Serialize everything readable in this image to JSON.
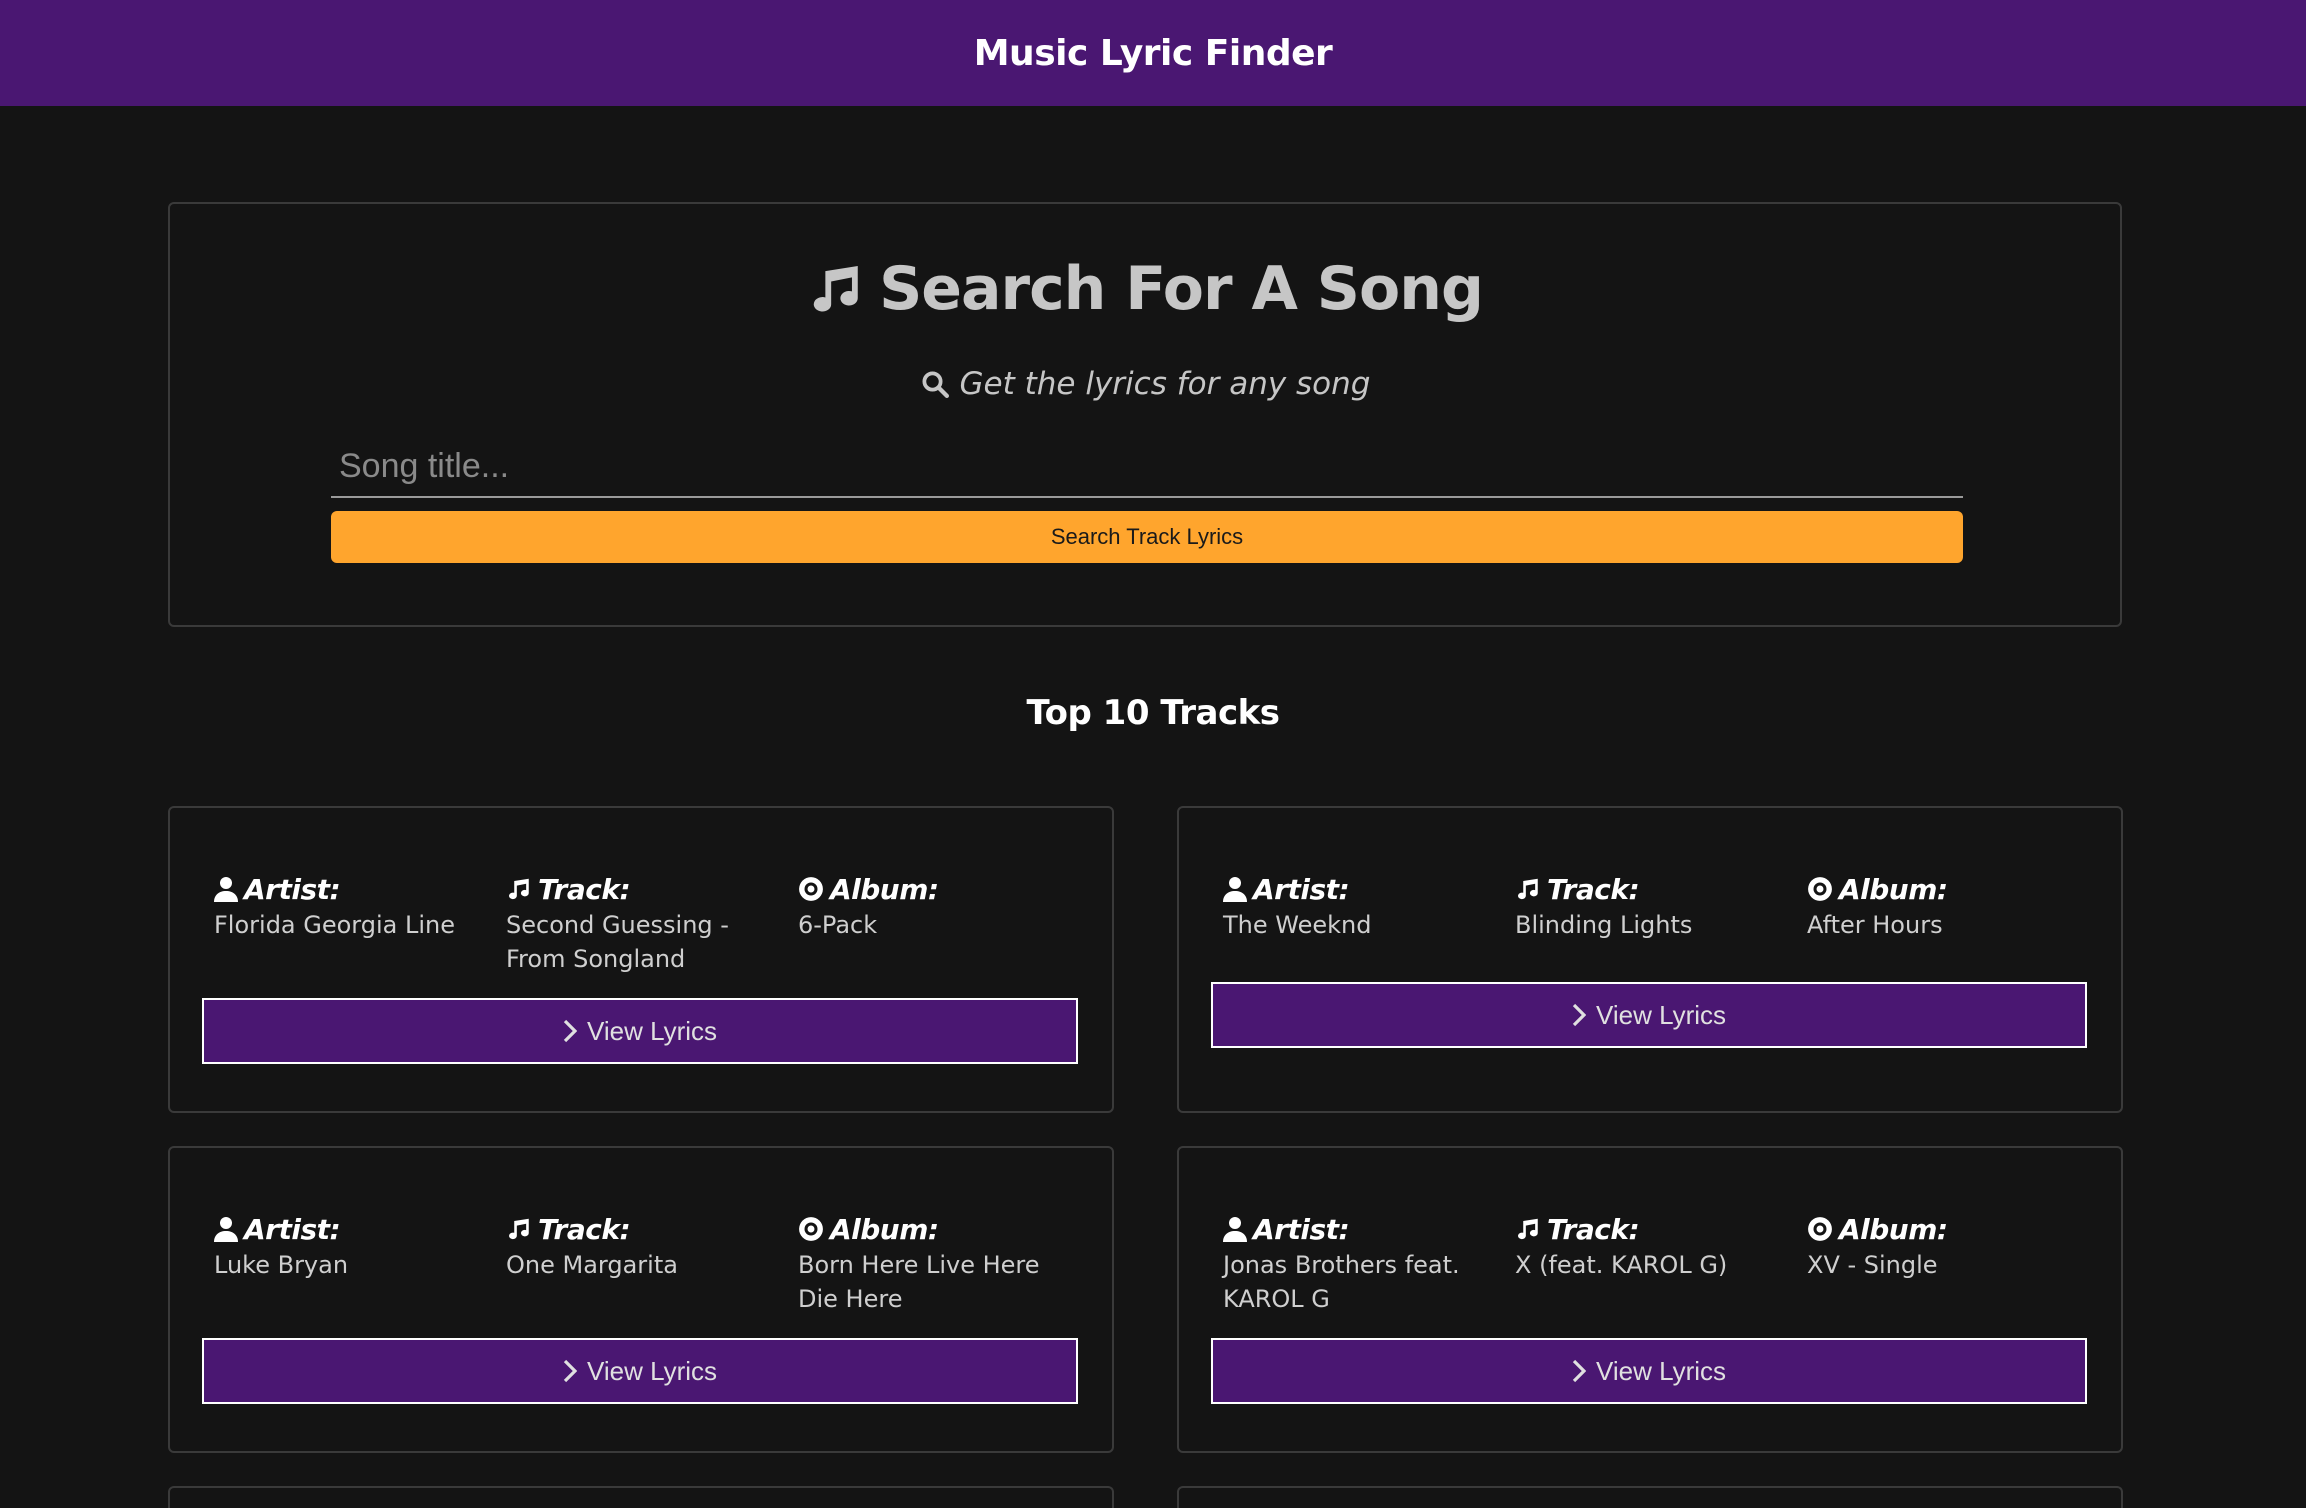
{
  "app": {
    "title": "Music Lyric Finder"
  },
  "search": {
    "title": "Search For A Song",
    "subtitle": "Get the lyrics for any song",
    "placeholder": "Song title...",
    "value": "",
    "button_label": "Search Track Lyrics",
    "title_icon": "music-note-icon",
    "subtitle_icon": "search-icon"
  },
  "top_tracks": {
    "title": "Top 10 Tracks",
    "labels": {
      "artist": "Artist:",
      "track": "Track:",
      "album": "Album:"
    },
    "button_label": "View Lyrics",
    "tracks": [
      {
        "artist": "Florida Georgia Line",
        "track": "Second Guessing - From Songland",
        "album": "6-Pack"
      },
      {
        "artist": "The Weeknd",
        "track": "Blinding Lights",
        "album": "After Hours"
      },
      {
        "artist": "Luke Bryan",
        "track": "One Margarita",
        "album": "Born Here Live Here Die Here"
      },
      {
        "artist": "Jonas Brothers feat. KAROL G",
        "track": "X (feat. KAROL G)",
        "album": "XV - Single"
      }
    ]
  },
  "colors": {
    "navbar": "#4a1772",
    "background": "#141414",
    "accent": "#ffa52d",
    "button_purple": "#4a1772"
  }
}
